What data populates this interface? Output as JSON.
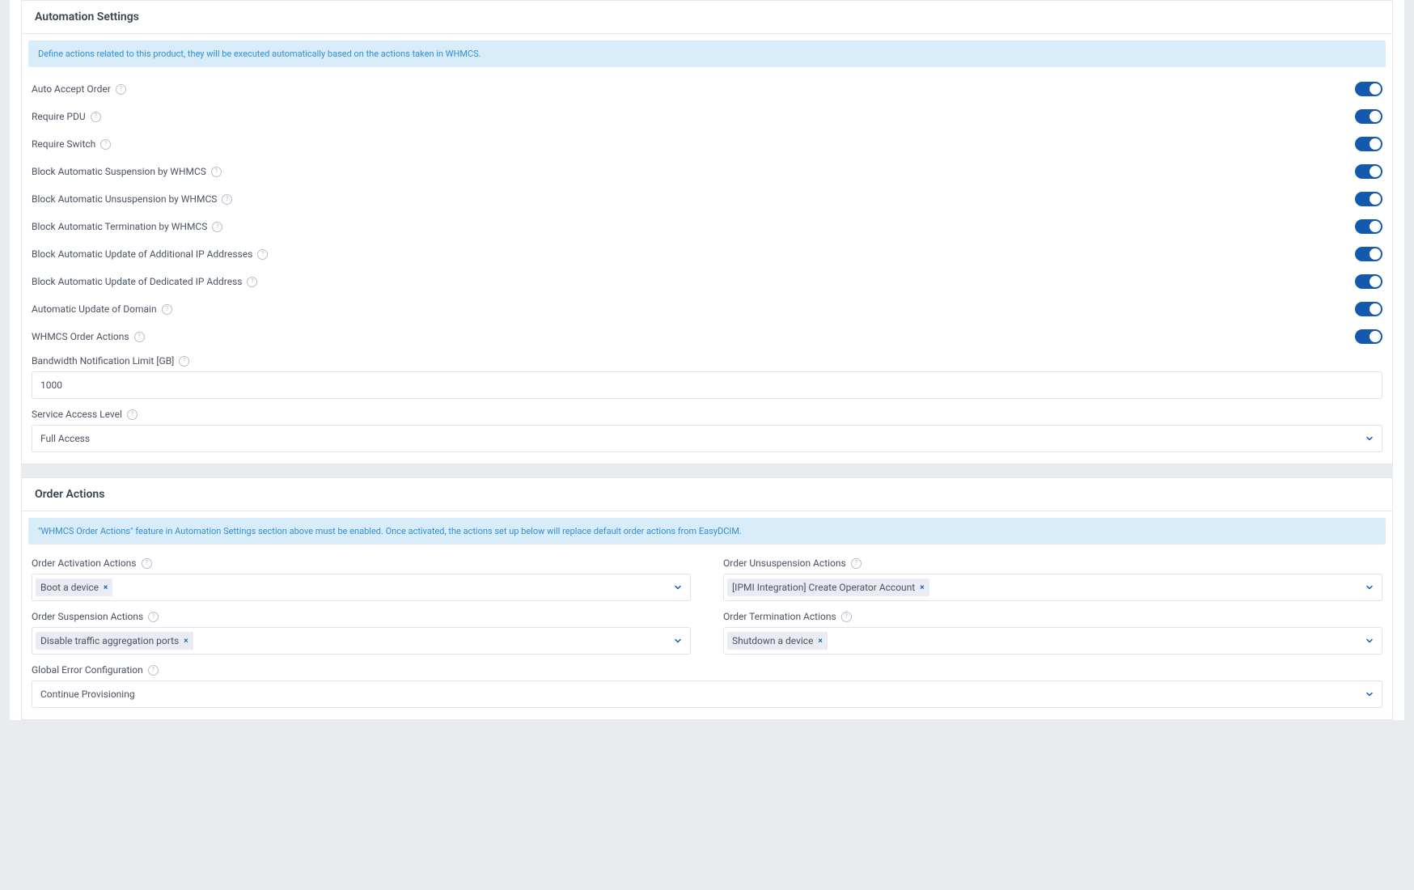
{
  "automation": {
    "title": "Automation Settings",
    "banner": "Define actions related to this product, they will be executed automatically based on the actions taken in WHMCS.",
    "toggles": [
      {
        "key": "auto-accept-order",
        "label": "Auto Accept Order",
        "on": true
      },
      {
        "key": "require-pdu",
        "label": "Require PDU",
        "on": true
      },
      {
        "key": "require-switch",
        "label": "Require Switch",
        "on": true
      },
      {
        "key": "block-auto-suspension",
        "label": "Block Automatic Suspension by WHMCS",
        "on": true
      },
      {
        "key": "block-auto-unsuspension",
        "label": "Block Automatic Unsuspension by WHMCS",
        "on": true
      },
      {
        "key": "block-auto-termination",
        "label": "Block Automatic Termination by WHMCS",
        "on": true
      },
      {
        "key": "block-auto-update-additional-ip",
        "label": "Block Automatic Update of Additional IP Addresses",
        "on": true
      },
      {
        "key": "block-auto-update-dedicated-ip",
        "label": "Block Automatic Update of Dedicated IP Address",
        "on": true
      },
      {
        "key": "auto-update-domain",
        "label": "Automatic Update of Domain",
        "on": true
      },
      {
        "key": "whmcs-order-actions",
        "label": "WHMCS Order Actions",
        "on": true
      }
    ],
    "bandwidth": {
      "label": "Bandwidth Notification Limit [GB]",
      "value": "1000"
    },
    "serviceAccess": {
      "label": "Service Access Level",
      "value": "Full Access"
    }
  },
  "orderActions": {
    "title": "Order Actions",
    "banner": "\"WHMCS Order Actions\" feature in Automation Settings section above must be enabled. Once activated, the actions set up below will replace default order actions from EasyDCIM.",
    "activation": {
      "label": "Order Activation Actions",
      "tags": [
        "Boot a device"
      ]
    },
    "unsuspension": {
      "label": "Order Unsuspension Actions",
      "tags": [
        "[IPMI Integration] Create Operator Account"
      ]
    },
    "suspension": {
      "label": "Order Suspension Actions",
      "tags": [
        "Disable traffic aggregation ports"
      ]
    },
    "termination": {
      "label": "Order Termination Actions",
      "tags": [
        "Shutdown a device"
      ]
    },
    "globalError": {
      "label": "Global Error Configuration",
      "value": "Continue Provisioning"
    }
  }
}
